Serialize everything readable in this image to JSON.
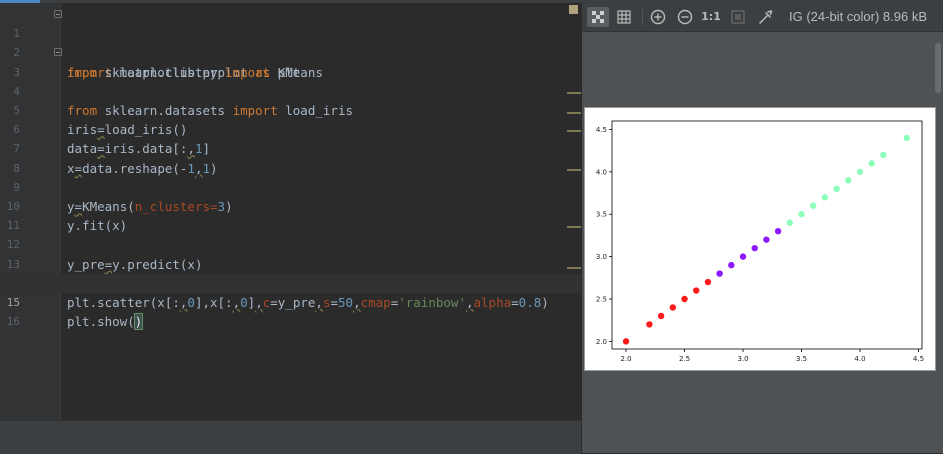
{
  "editor": {
    "lines": [
      {
        "n": "1"
      },
      {
        "n": "2"
      },
      {
        "n": "3"
      },
      {
        "n": "4"
      },
      {
        "n": "5"
      },
      {
        "n": "6"
      },
      {
        "n": "7"
      },
      {
        "n": "8"
      },
      {
        "n": "9"
      },
      {
        "n": "10"
      },
      {
        "n": "11"
      },
      {
        "n": "12"
      },
      {
        "n": "13"
      },
      {
        "n": "14"
      },
      {
        "n": "15"
      },
      {
        "n": "16"
      }
    ],
    "code": {
      "l1": [
        "import",
        " matplotlib.pyplot ",
        "as",
        " plt"
      ],
      "l2": [
        "from",
        " sklearn.cluster ",
        "import",
        " KMeans"
      ],
      "l3": [
        "from",
        " sklearn.datasets ",
        "import",
        " load_iris"
      ],
      "l5": [
        "iris",
        "=",
        "load_iris()"
      ],
      "l6": [
        "data",
        "=",
        "iris.data[:",
        ",",
        "1",
        "]"
      ],
      "l7": [
        "x",
        "=",
        "data.reshape(-",
        "1",
        ",",
        "1",
        ")"
      ],
      "l9": [
        "y",
        "=",
        "KMeans(",
        "n_clusters",
        "=",
        "3",
        ")"
      ],
      "l10": [
        "y.fit(x)"
      ],
      "l12": [
        "y_pre",
        "=",
        "y.predict(x)"
      ],
      "l14": [
        "plt.scatter(x[:",
        ",",
        "0",
        "],x[:",
        ",",
        "0",
        "]",
        ",",
        "c",
        "=y_pre",
        ",",
        "s",
        "=",
        "50",
        ",",
        "cmap",
        "=",
        "'rainbow'",
        ",",
        "alpha",
        "=",
        "0.8",
        ")"
      ],
      "l15": [
        "plt.show(",
        ")"
      ]
    }
  },
  "viewer": {
    "toolbar": {
      "transparency_icon": "checker-icon",
      "grid_icon": "grid-icon",
      "zoom_in_icon": "zoom-in-icon",
      "zoom_out_icon": "zoom-out-icon",
      "actual_size_label": "1:1",
      "fit_icon": "fit-icon",
      "color_picker_icon": "eyedropper-icon"
    },
    "image_info": "IG (24-bit color) 8.96 kB"
  },
  "chart_data": {
    "type": "scatter",
    "xlim": [
      1.88,
      4.53
    ],
    "ylim": [
      1.91,
      4.6
    ],
    "xticks": [
      "2.0",
      "2.5",
      "3.0",
      "3.5",
      "4.0",
      "4.5"
    ],
    "yticks": [
      "2.0",
      "2.5",
      "3.0",
      "3.5",
      "4.0",
      "4.5"
    ],
    "grid": false,
    "colors": {
      "red": "#ff0000",
      "purple": "#8000ff",
      "green": "#80ffb4"
    },
    "points": [
      {
        "x": 2.0,
        "y": 2.0,
        "c": "red"
      },
      {
        "x": 2.2,
        "y": 2.2,
        "c": "red"
      },
      {
        "x": 2.3,
        "y": 2.3,
        "c": "red"
      },
      {
        "x": 2.4,
        "y": 2.4,
        "c": "red"
      },
      {
        "x": 2.5,
        "y": 2.5,
        "c": "red"
      },
      {
        "x": 2.6,
        "y": 2.6,
        "c": "red"
      },
      {
        "x": 2.7,
        "y": 2.7,
        "c": "red"
      },
      {
        "x": 2.8,
        "y": 2.8,
        "c": "purple"
      },
      {
        "x": 2.9,
        "y": 2.9,
        "c": "purple"
      },
      {
        "x": 3.0,
        "y": 3.0,
        "c": "purple"
      },
      {
        "x": 3.1,
        "y": 3.1,
        "c": "purple"
      },
      {
        "x": 3.2,
        "y": 3.2,
        "c": "purple"
      },
      {
        "x": 3.3,
        "y": 3.3,
        "c": "purple"
      },
      {
        "x": 3.4,
        "y": 3.4,
        "c": "green"
      },
      {
        "x": 3.5,
        "y": 3.5,
        "c": "green"
      },
      {
        "x": 3.6,
        "y": 3.6,
        "c": "green"
      },
      {
        "x": 3.7,
        "y": 3.7,
        "c": "green"
      },
      {
        "x": 3.8,
        "y": 3.8,
        "c": "green"
      },
      {
        "x": 3.9,
        "y": 3.9,
        "c": "green"
      },
      {
        "x": 4.0,
        "y": 4.0,
        "c": "green"
      },
      {
        "x": 4.1,
        "y": 4.1,
        "c": "green"
      },
      {
        "x": 4.2,
        "y": 4.2,
        "c": "green"
      },
      {
        "x": 4.4,
        "y": 4.4,
        "c": "green"
      }
    ]
  }
}
